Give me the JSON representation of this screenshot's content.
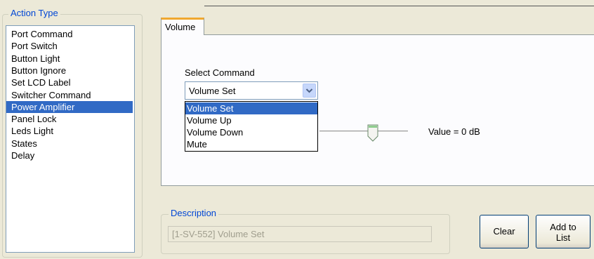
{
  "action_type": {
    "legend": "Action Type",
    "items": [
      {
        "label": "Port Command"
      },
      {
        "label": "Port Switch"
      },
      {
        "label": "Button Light"
      },
      {
        "label": "Button Ignore"
      },
      {
        "label": "Set LCD Label"
      },
      {
        "label": "Switcher Command"
      },
      {
        "label": "Power Amplifier",
        "selected": true
      },
      {
        "label": "Panel Lock"
      },
      {
        "label": "Leds Light"
      },
      {
        "label": "States"
      },
      {
        "label": "Delay"
      }
    ]
  },
  "tabs": [
    {
      "label": "Volume",
      "active": true
    }
  ],
  "volume": {
    "select_label": "Select Command",
    "combo_value": "Volume Set",
    "options": [
      "Volume Set",
      "Volume Up",
      "Volume Down",
      "Mute"
    ],
    "selected_index": 0,
    "value_text": "Value = 0 dB"
  },
  "description": {
    "legend": "Description",
    "value": "[1-SV-552] Volume Set"
  },
  "buttons": {
    "clear": "Clear",
    "add_line1": "Add to",
    "add_line2": "List"
  },
  "icons": {
    "combo_arrow": "chevron-down-icon",
    "slider_thumb": "slider-thumb-icon"
  }
}
